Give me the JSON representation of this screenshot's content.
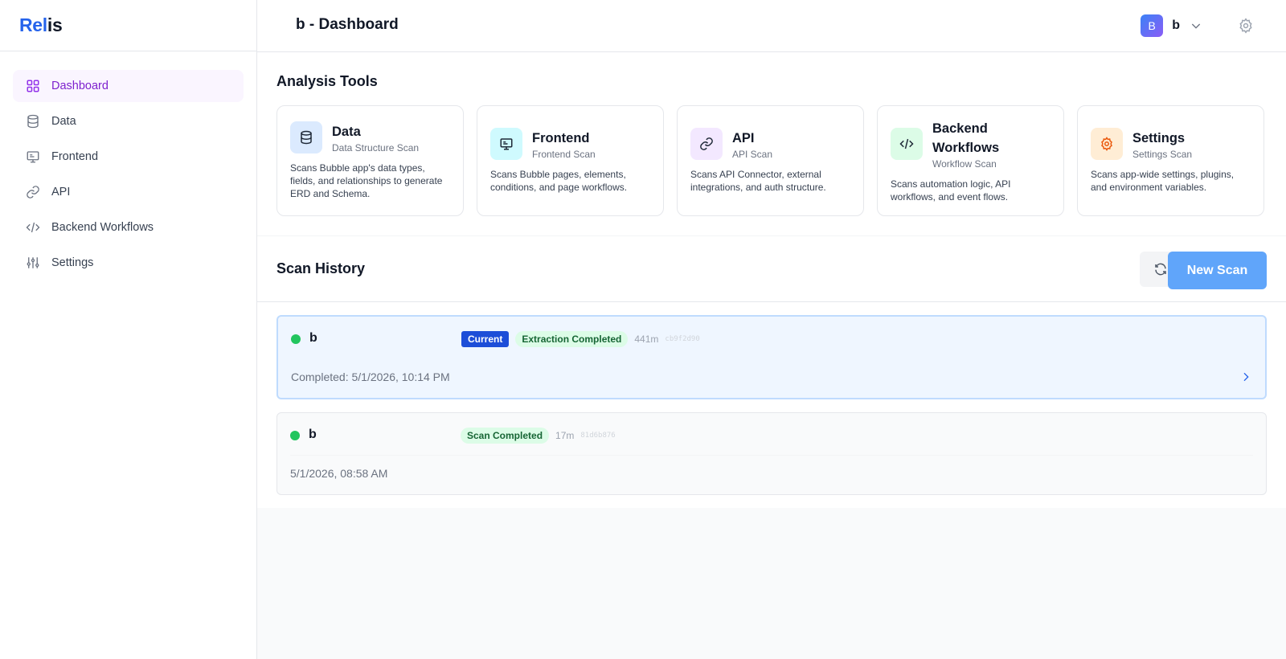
{
  "brand": {
    "part1": "Rel",
    "part2": "is"
  },
  "sidebar": {
    "items": [
      {
        "label": "Dashboard",
        "icon": "grid-icon",
        "active": true
      },
      {
        "label": "Data",
        "icon": "database-icon",
        "active": false
      },
      {
        "label": "Frontend",
        "icon": "monitor-icon",
        "active": false
      },
      {
        "label": "API",
        "icon": "link-icon",
        "active": false
      },
      {
        "label": "Backend Workflows",
        "icon": "code-icon",
        "active": false
      },
      {
        "label": "Settings",
        "icon": "sliders-icon",
        "active": false
      }
    ]
  },
  "header": {
    "title": "b - Dashboard",
    "user": {
      "initial": "B",
      "name": "b"
    }
  },
  "tools": {
    "title": "Analysis Tools",
    "cards": [
      {
        "title": "Data",
        "subtitle": "Data Structure Scan",
        "description": "Scans Bubble app's data types, fields, and relationships to generate ERD and Schema.",
        "icon": "database-icon",
        "color": "#dbeafe"
      },
      {
        "title": "Frontend",
        "subtitle": "Frontend Scan",
        "description": "Scans Bubble pages, elements, conditions, and page workflows.",
        "icon": "monitor-icon",
        "color": "#cffafe"
      },
      {
        "title": "API",
        "subtitle": "API Scan",
        "description": "Scans API Connector, external integrations, and auth structure.",
        "icon": "link-icon",
        "color": "#f3e8ff"
      },
      {
        "title": "Backend Workflows",
        "subtitle": "Workflow Scan",
        "description": "Scans automation logic, API workflows, and event flows.",
        "icon": "code-icon",
        "color": "#dcfce7"
      },
      {
        "title": "Settings",
        "subtitle": "Settings Scan",
        "description": "Scans app-wide settings, plugins, and environment variables.",
        "icon": "gear-icon",
        "color": "#ffedd5"
      }
    ]
  },
  "history": {
    "title": "Scan History",
    "new_scan_label": "New Scan",
    "scans": [
      {
        "name": "b",
        "current_badge": "Current",
        "status": "Extraction Completed",
        "duration": "441m",
        "hash": "cb9f2d90",
        "date": "Completed: 5/1/2026, 10:14 PM"
      },
      {
        "name": "b",
        "status": "Scan Completed",
        "duration": "17m",
        "hash": "81d6b876",
        "date": "5/1/2026, 08:58 AM"
      }
    ]
  }
}
